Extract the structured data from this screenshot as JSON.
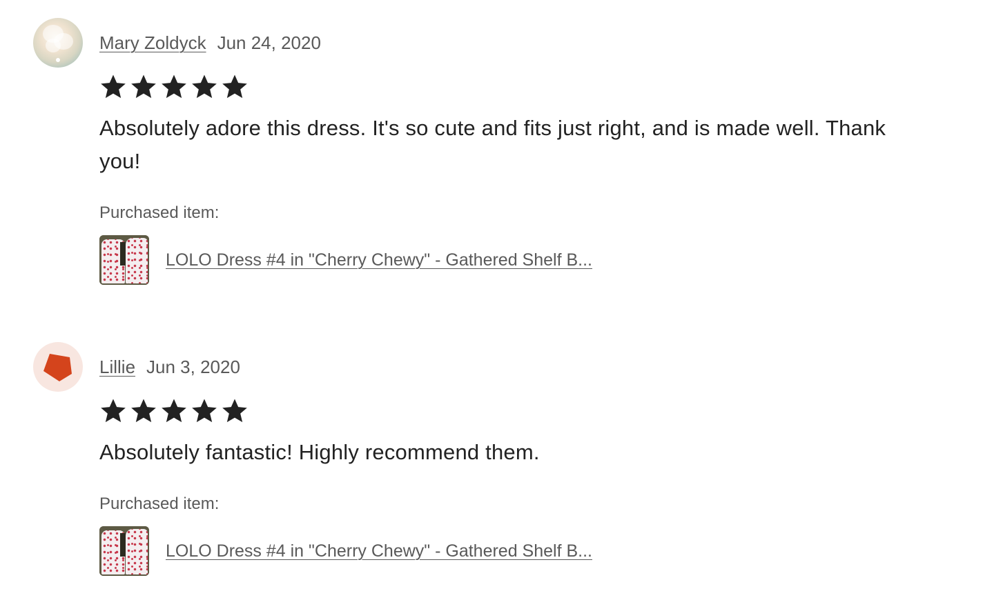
{
  "reviews": [
    {
      "reviewer": "Mary Zoldyck",
      "date": "Jun 24, 2020",
      "rating": 5,
      "text": "Absolutely adore this dress. It's so cute and fits just right, and is made well. Thank you!",
      "purchased_label": "Purchased item:",
      "item_title": "LOLO Dress #4 in \"Cherry Chewy\" - Gathered Shelf B...",
      "avatar_icon": "flower-photo-avatar"
    },
    {
      "reviewer": "Lillie",
      "date": "Jun 3, 2020",
      "rating": 5,
      "text": "Absolutely fantastic! Highly recommend them.",
      "purchased_label": "Purchased item:",
      "item_title": "LOLO Dress #4 in \"Cherry Chewy\" - Gathered Shelf B...",
      "avatar_icon": "red-pentagon-avatar"
    }
  ],
  "colors": {
    "text": "#222222",
    "muted": "#595959",
    "star": "#222222",
    "avatar_shape": "#d4441c",
    "avatar_bg": "#f8e6e0"
  }
}
